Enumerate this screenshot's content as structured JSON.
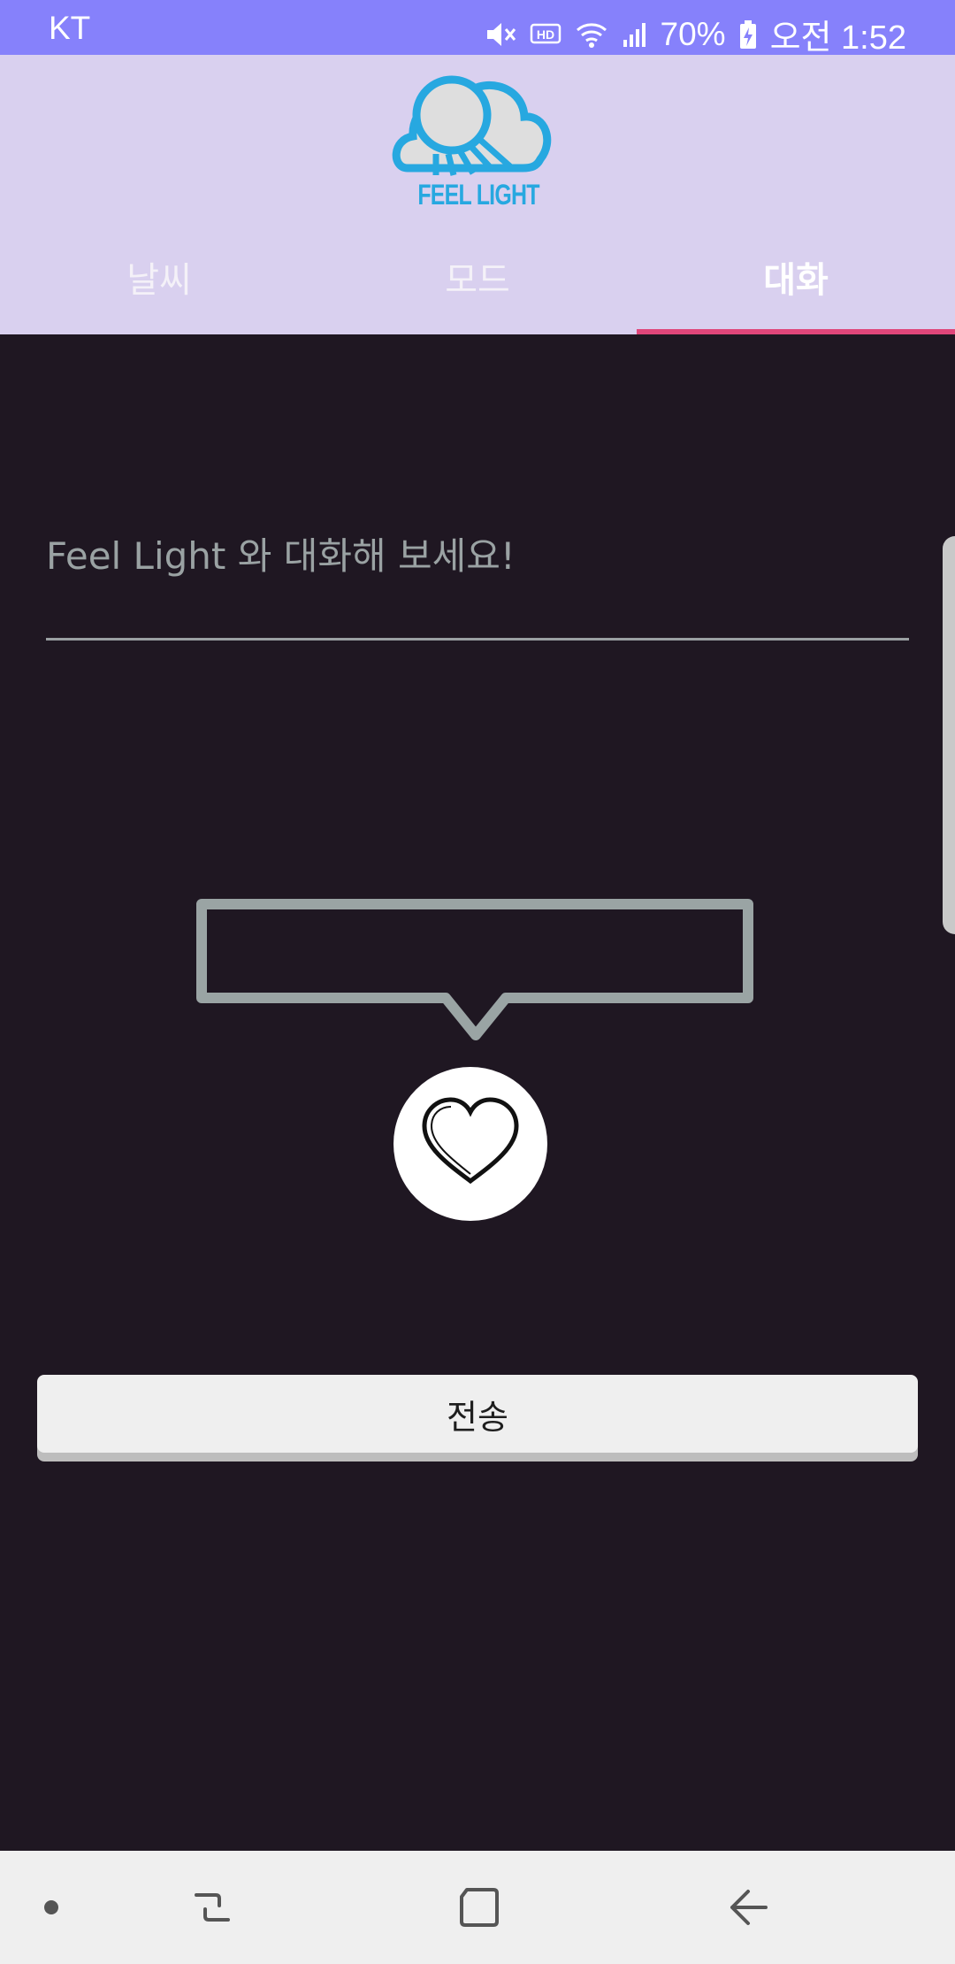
{
  "status_bar": {
    "carrier": "KT",
    "battery": "70%",
    "time": "오전 1:52",
    "icons": [
      "mute-icon",
      "hd-icon",
      "wifi-icon",
      "signal-icon",
      "battery-charging-icon"
    ]
  },
  "header": {
    "logo_text": "FEEL LIGHT",
    "logo_icon": "sun-cloud-logo",
    "brand_color": "#27a8e0"
  },
  "tabs": [
    {
      "label": "날씨",
      "active": false
    },
    {
      "label": "모드",
      "active": false
    },
    {
      "label": "대화",
      "active": true
    }
  ],
  "chat": {
    "input_placeholder": "Feel Light 와 대화해 보세요!",
    "input_value": "",
    "bubble_text": "",
    "heart_icon": "heart-icon",
    "send_label": "전송"
  },
  "colors": {
    "status_bar": "#8681fb",
    "header_bg": "#d9d0ef",
    "tab_indicator": "#e0467a",
    "body_bg": "#1f1722"
  },
  "nav_bar": {
    "items": [
      "nav-dot-icon",
      "recent-apps-icon",
      "home-icon",
      "back-icon"
    ]
  }
}
